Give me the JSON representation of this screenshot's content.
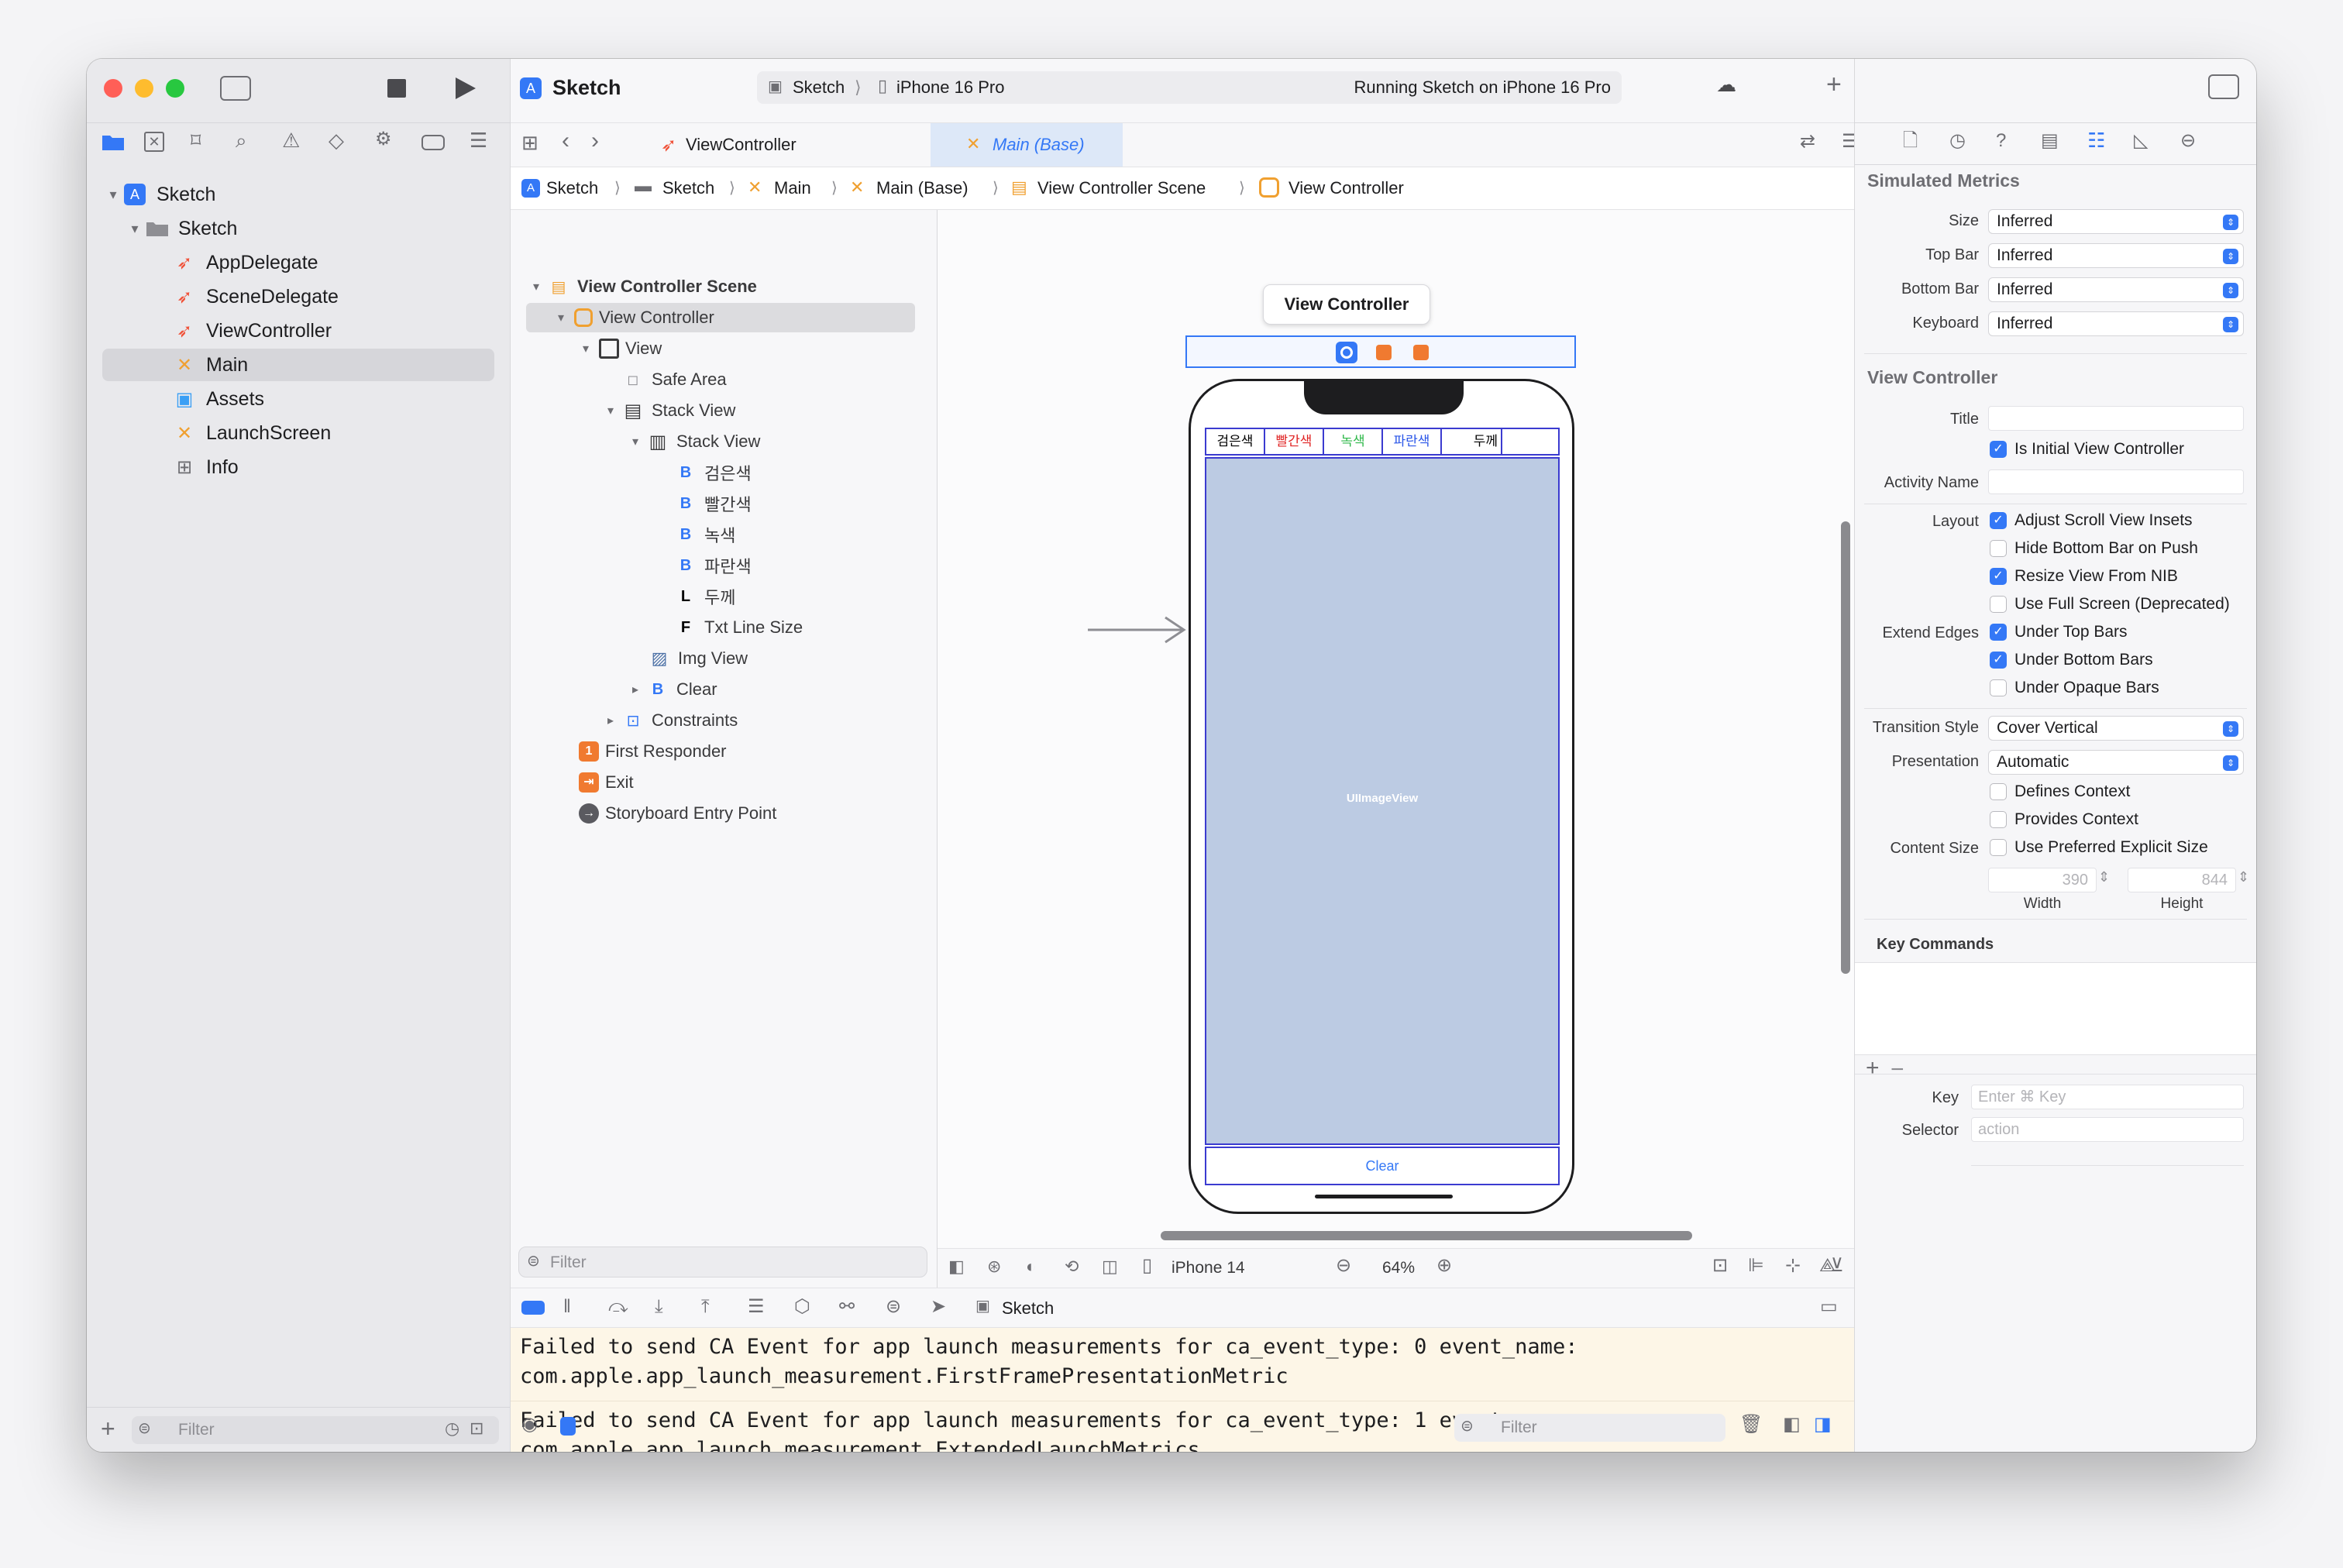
{
  "toolbar": {
    "project": "Sketch",
    "scheme": "Sketch",
    "device": "iPhone 16 Pro",
    "status": "Running Sketch on iPhone 16 Pro"
  },
  "tabs": [
    {
      "label": "ViewController"
    },
    {
      "label": "Main (Base)"
    }
  ],
  "breadcrumb": [
    "Sketch",
    "Sketch",
    "Main",
    "Main (Base)",
    "View Controller Scene",
    "View Controller"
  ],
  "navigator": {
    "items": [
      {
        "label": "Sketch"
      },
      {
        "label": "Sketch"
      },
      {
        "label": "AppDelegate"
      },
      {
        "label": "SceneDelegate"
      },
      {
        "label": "ViewController"
      },
      {
        "label": "Main"
      },
      {
        "label": "Assets"
      },
      {
        "label": "LaunchScreen"
      },
      {
        "label": "Info"
      }
    ],
    "filter_placeholder": "Filter"
  },
  "outline": {
    "items": [
      {
        "label": "View Controller Scene"
      },
      {
        "label": "View Controller"
      },
      {
        "label": "View"
      },
      {
        "label": "Safe Area"
      },
      {
        "label": "Stack View"
      },
      {
        "label": "Stack View"
      },
      {
        "label": "검은색",
        "prefix": "B"
      },
      {
        "label": "빨간색",
        "prefix": "B"
      },
      {
        "label": "녹색",
        "prefix": "B"
      },
      {
        "label": "파란색",
        "prefix": "B"
      },
      {
        "label": "두께",
        "prefix": "L"
      },
      {
        "label": "Txt Line Size",
        "prefix": "F"
      },
      {
        "label": "Img View"
      },
      {
        "label": "Clear",
        "prefix": "B"
      },
      {
        "label": "Constraints"
      },
      {
        "label": "First Responder",
        "prefix": "1"
      },
      {
        "label": "Exit"
      },
      {
        "label": "Storyboard Entry Point"
      }
    ],
    "filter_placeholder": "Filter"
  },
  "canvas": {
    "scene_title": "View Controller",
    "buttons": [
      {
        "label": "검은색",
        "color": "#000000"
      },
      {
        "label": "빨간색",
        "color": "#e02424"
      },
      {
        "label": "녹색",
        "color": "#2fb84a"
      },
      {
        "label": "파란색",
        "color": "#2a56e8"
      }
    ],
    "thickness_label": "두께",
    "image_view_label": "UIImageView",
    "clear_label": "Clear",
    "device": "iPhone 14",
    "zoom": "64%"
  },
  "debug_bar": {
    "target": "Sketch"
  },
  "console": {
    "lines": [
      "Failed to send CA Event for app launch measurements for ca_event_type: 0 event_name:",
      "com.apple.app_launch_measurement.FirstFramePresentationMetric",
      "Failed to send CA Event for app launch measurements for ca_event_type: 1 event_name:",
      "com.apple.app_launch_measurement.ExtendedLaunchMetrics"
    ],
    "filter_placeholder": "Filter"
  },
  "inspector": {
    "simulated_metrics": {
      "title": "Simulated Metrics",
      "rows": [
        {
          "label": "Size",
          "value": "Inferred"
        },
        {
          "label": "Top Bar",
          "value": "Inferred"
        },
        {
          "label": "Bottom Bar",
          "value": "Inferred"
        },
        {
          "label": "Keyboard",
          "value": "Inferred"
        }
      ]
    },
    "view_controller": {
      "title": "View Controller",
      "title_label": "Title",
      "is_initial": "Is Initial View Controller",
      "activity_name_label": "Activity Name",
      "layout_label": "Layout",
      "layout_opts": [
        {
          "label": "Adjust Scroll View Insets",
          "checked": true
        },
        {
          "label": "Hide Bottom Bar on Push",
          "checked": false
        },
        {
          "label": "Resize View From NIB",
          "checked": true
        },
        {
          "label": "Use Full Screen (Deprecated)",
          "checked": false
        }
      ],
      "extend_edges_label": "Extend Edges",
      "extend_opts": [
        {
          "label": "Under Top Bars",
          "checked": true
        },
        {
          "label": "Under Bottom Bars",
          "checked": true
        },
        {
          "label": "Under Opaque Bars",
          "checked": false
        }
      ],
      "transition_label": "Transition Style",
      "transition_value": "Cover Vertical",
      "presentation_label": "Presentation",
      "presentation_value": "Automatic",
      "context_opts": [
        {
          "label": "Defines Context",
          "checked": false
        },
        {
          "label": "Provides Context",
          "checked": false
        }
      ],
      "content_size_label": "Content Size",
      "content_size_opt": "Use Preferred Explicit Size",
      "width": "390",
      "height": "844",
      "width_label": "Width",
      "height_label": "Height"
    },
    "key_commands": {
      "title": "Key Commands",
      "key_label": "Key",
      "key_placeholder": "Enter ⌘ Key",
      "selector_label": "Selector",
      "selector_placeholder": "action"
    }
  }
}
